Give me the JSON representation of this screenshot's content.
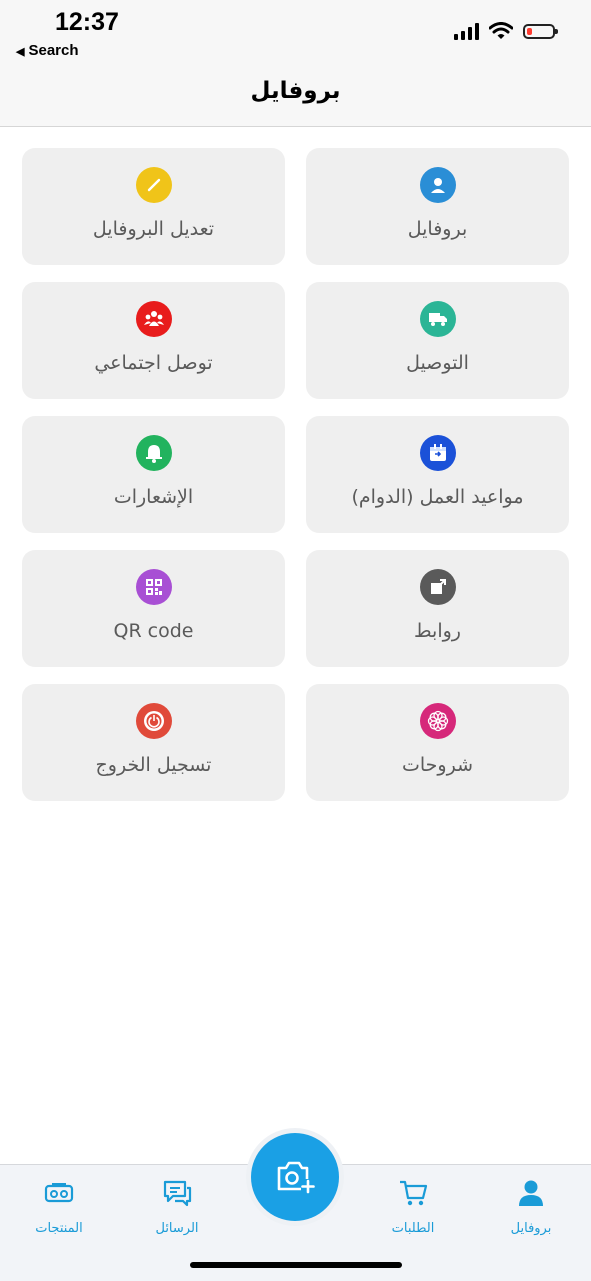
{
  "status_bar": {
    "time": "12:37",
    "back_label": "Search"
  },
  "header": {
    "title": "بروفايل"
  },
  "tiles": [
    {
      "label": "بروفايل",
      "icon": "user-icon",
      "color": "#2a8ed6"
    },
    {
      "label": "تعديل البروفايل",
      "icon": "pencil-icon",
      "color": "#f0c419"
    },
    {
      "label": "التوصيل",
      "icon": "delivery-truck-icon",
      "color": "#2bb596"
    },
    {
      "label": "توصل اجتماعي",
      "icon": "social-group-icon",
      "color": "#e81c1c"
    },
    {
      "label": "مواعيد العمل (الدوام)",
      "icon": "calendar-icon",
      "color": "#1b51d8"
    },
    {
      "label": "الإشعارات",
      "icon": "bell-icon",
      "color": "#22b35e"
    },
    {
      "label": "روابط",
      "icon": "external-link-icon",
      "color": "#5a5a5a"
    },
    {
      "label": "QR code",
      "icon": "qr-code-icon",
      "color": "#a84fd4"
    },
    {
      "label": "شروحات",
      "icon": "flower-icon",
      "color": "#d6287a"
    },
    {
      "label": "تسجيل الخروج",
      "icon": "power-icon",
      "color": "#e04a3a"
    }
  ],
  "tab_bar": {
    "profile": "بروفايل",
    "orders": "الطلبات",
    "camera": "camera-add-icon",
    "messages": "الرسائل",
    "products": "المنتجات",
    "accent": "#1a9bd7"
  }
}
